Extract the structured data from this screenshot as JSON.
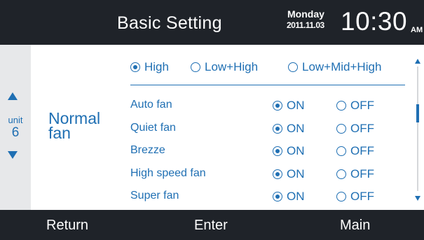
{
  "header": {
    "title": "Basic Setting",
    "day": "Monday",
    "date": "2011.11.03",
    "time": "10:30",
    "ampm": "AM"
  },
  "unit": {
    "label": "unit",
    "number": "6"
  },
  "fan_label": "Normal fan",
  "speed_options": [
    {
      "label": "High",
      "selected": true
    },
    {
      "label": "Low+High",
      "selected": false
    },
    {
      "label": "Low+Mid+High",
      "selected": false
    }
  ],
  "fan_modes": [
    {
      "name": "Auto fan",
      "on_label": "ON",
      "off_label": "OFF",
      "state": "ON"
    },
    {
      "name": "Quiet fan",
      "on_label": "ON",
      "off_label": "OFF",
      "state": "ON"
    },
    {
      "name": "Brezze",
      "on_label": "ON",
      "off_label": "OFF",
      "state": "ON"
    },
    {
      "name": "High speed fan",
      "on_label": "ON",
      "off_label": "OFF",
      "state": "ON"
    },
    {
      "name": "Super fan",
      "on_label": "ON",
      "off_label": "OFF",
      "state": "ON"
    }
  ],
  "footer": {
    "return_label": "Return",
    "enter_label": "Enter",
    "main_label": "Main"
  },
  "colors": {
    "accent": "#1f6fb3",
    "bar": "#1f2329",
    "panel": "#e7e8ea"
  },
  "icons": {
    "unit_up": "triangle-up-icon",
    "unit_down": "triangle-down-icon",
    "scroll_up": "triangle-up-icon",
    "scroll_down": "triangle-down-icon"
  }
}
